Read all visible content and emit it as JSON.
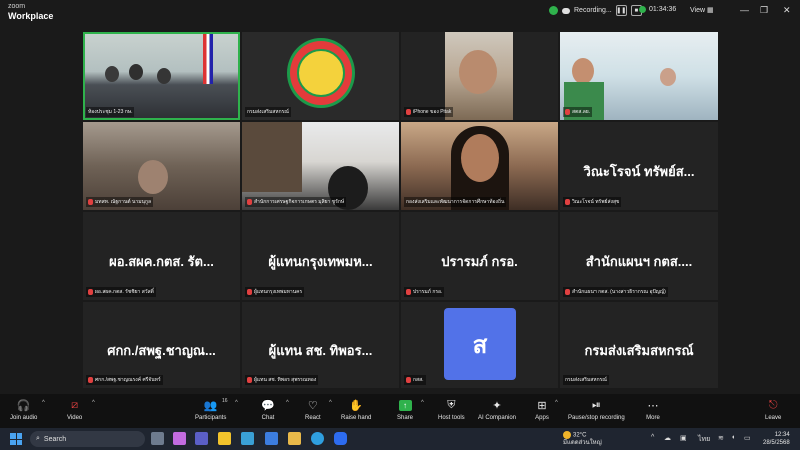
{
  "titlebar": {
    "brand_line1": "zoom",
    "brand_line2": "Workplace",
    "recording_label": "Recording...",
    "timer": "01:34:36",
    "view_label": "View"
  },
  "tiles": [
    {
      "label": "ห้องประชุม 1-23 กษ.",
      "type": "video",
      "style": "room"
    },
    {
      "label": "กรมส่งเสริมสหกรณ์",
      "type": "video",
      "style": "logo"
    },
    {
      "label": "iPhone ของ Pitak",
      "type": "video",
      "style": "man"
    },
    {
      "label": "สตส.ลย.",
      "type": "video",
      "style": "office"
    },
    {
      "label": "มทสท. ณัฐกานต์ นามนุกูล",
      "type": "video",
      "style": "blur"
    },
    {
      "label": "สำนักการเศรษฐกิจการเกษตร มุสิยา ชูรักษ์",
      "type": "video",
      "style": "office2"
    },
    {
      "label": "กองส่งเสริมและพัฒนาการจัดการศึกษาท้องถิ่น",
      "type": "video",
      "style": "woman"
    },
    {
      "label": "วิณะโรจน์ ทรัพย์ส่งสุข",
      "type": "name",
      "display": "วิณะโรจน์ ทรัพย์ส..."
    },
    {
      "label": "ผอ.สผค.กตส. รัชชิยา สวัสดิ์",
      "type": "name",
      "display": "ผอ.สผค.กตส. รัต..."
    },
    {
      "label": "ผู้แทนกรุงเทพมหานคร",
      "type": "name",
      "display": "ผู้แทนกรุงเทพมห..."
    },
    {
      "label": "ปรารมภ์ กรอ.",
      "type": "name",
      "display": "ปรารมภ์ กรอ."
    },
    {
      "label": "สำนักแผนฯ กตส. (นางสาวธิรากรณ อุปัญญ์)",
      "type": "name",
      "display": "สำนักแผนฯ กตส...."
    },
    {
      "label": "ศกก./สพฐ.ชาญณรงค์ ศรีจันทร์",
      "type": "name",
      "display": "ศกก./สพฐ.ชาญณ..."
    },
    {
      "label": "ผู้แทน สช. ทิพอร สุพรรณทอง",
      "type": "name",
      "display": "ผู้แทน สช. ทิพอร..."
    },
    {
      "label": "กสส.",
      "type": "avatar",
      "display": "ส"
    },
    {
      "label": "กรมส่งเสริมสหกรณ์",
      "type": "name",
      "display": "กรมส่งเสริมสหกรณ์"
    }
  ],
  "toolbar": {
    "join_audio": "Join audio",
    "video": "Video",
    "participants": "Participants",
    "participants_count": "16",
    "chat": "Chat",
    "react": "React",
    "raise_hand": "Raise hand",
    "share": "Share",
    "host_tools": "Host tools",
    "ai_companion": "AI Companion",
    "apps": "Apps",
    "pause_stop": "Pause/stop recording",
    "more": "More",
    "leave": "Leave"
  },
  "taskbar": {
    "search_label": "Search",
    "weather_temp": "32°C",
    "weather_text": "มีแดดส่วนใหญ่",
    "lang": "ไทย",
    "time": "12:34",
    "date": "28/5/2568"
  },
  "colors": {
    "recording_green": "#2fb24c",
    "mic_off_red": "#e04040",
    "avatar_blue": "#5272e8",
    "tile_bg": "#232323"
  }
}
